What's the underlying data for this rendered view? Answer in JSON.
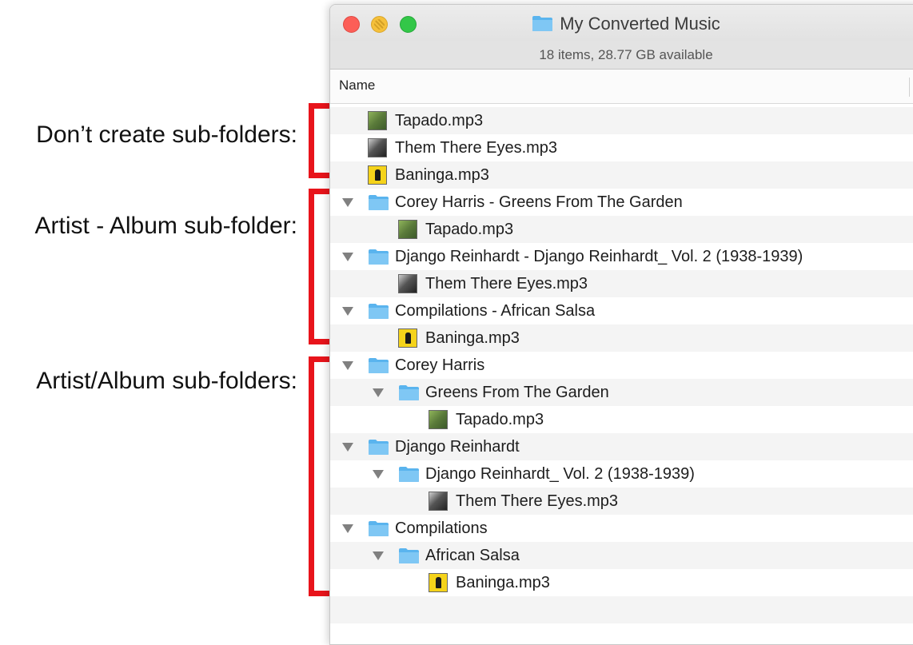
{
  "annotations": [
    {
      "label": "Don’t create sub-folders:"
    },
    {
      "label": "Artist - Album sub-folder:"
    },
    {
      "label": "Artist/Album sub-folders:"
    }
  ],
  "colors": {
    "bracket": "#e8141b",
    "folder": "#5ab4ee"
  },
  "window": {
    "title": "My Converted Music",
    "title_icon": "folder-icon",
    "status": "18 items, 28.77 GB available",
    "column_header": "Name"
  },
  "rows": [
    {
      "name": "Tapado.mp3",
      "kind": "file",
      "art": "green",
      "level": 0,
      "expanded": false
    },
    {
      "name": "Them There Eyes.mp3",
      "kind": "file",
      "art": "dark",
      "level": 0,
      "expanded": false
    },
    {
      "name": "Baninga.mp3",
      "kind": "file",
      "art": "yellow",
      "level": 0,
      "expanded": false
    },
    {
      "name": "Corey Harris - Greens From The Garden",
      "kind": "folder",
      "level": 0,
      "expanded": true
    },
    {
      "name": "Tapado.mp3",
      "kind": "file",
      "art": "green",
      "level": 1,
      "expanded": false
    },
    {
      "name": "Django Reinhardt - Django Reinhardt_ Vol. 2 (1938-1939)",
      "kind": "folder",
      "level": 0,
      "expanded": true
    },
    {
      "name": "Them There Eyes.mp3",
      "kind": "file",
      "art": "dark",
      "level": 1,
      "expanded": false
    },
    {
      "name": "Compilations - African Salsa",
      "kind": "folder",
      "level": 0,
      "expanded": true
    },
    {
      "name": "Baninga.mp3",
      "kind": "file",
      "art": "yellow",
      "level": 1,
      "expanded": false
    },
    {
      "name": "Corey Harris",
      "kind": "folder",
      "level": 0,
      "expanded": true
    },
    {
      "name": "Greens From The Garden",
      "kind": "folder",
      "level": 1,
      "expanded": true
    },
    {
      "name": "Tapado.mp3",
      "kind": "file",
      "art": "green",
      "level": 2,
      "expanded": false
    },
    {
      "name": "Django Reinhardt",
      "kind": "folder",
      "level": 0,
      "expanded": true
    },
    {
      "name": "Django Reinhardt_ Vol. 2 (1938-1939)",
      "kind": "folder",
      "level": 1,
      "expanded": true
    },
    {
      "name": "Them There Eyes.mp3",
      "kind": "file",
      "art": "dark",
      "level": 2,
      "expanded": false
    },
    {
      "name": "Compilations",
      "kind": "folder",
      "level": 0,
      "expanded": true
    },
    {
      "name": "African Salsa",
      "kind": "folder",
      "level": 1,
      "expanded": true
    },
    {
      "name": "Baninga.mp3",
      "kind": "file",
      "art": "yellow",
      "level": 2,
      "expanded": false
    }
  ]
}
